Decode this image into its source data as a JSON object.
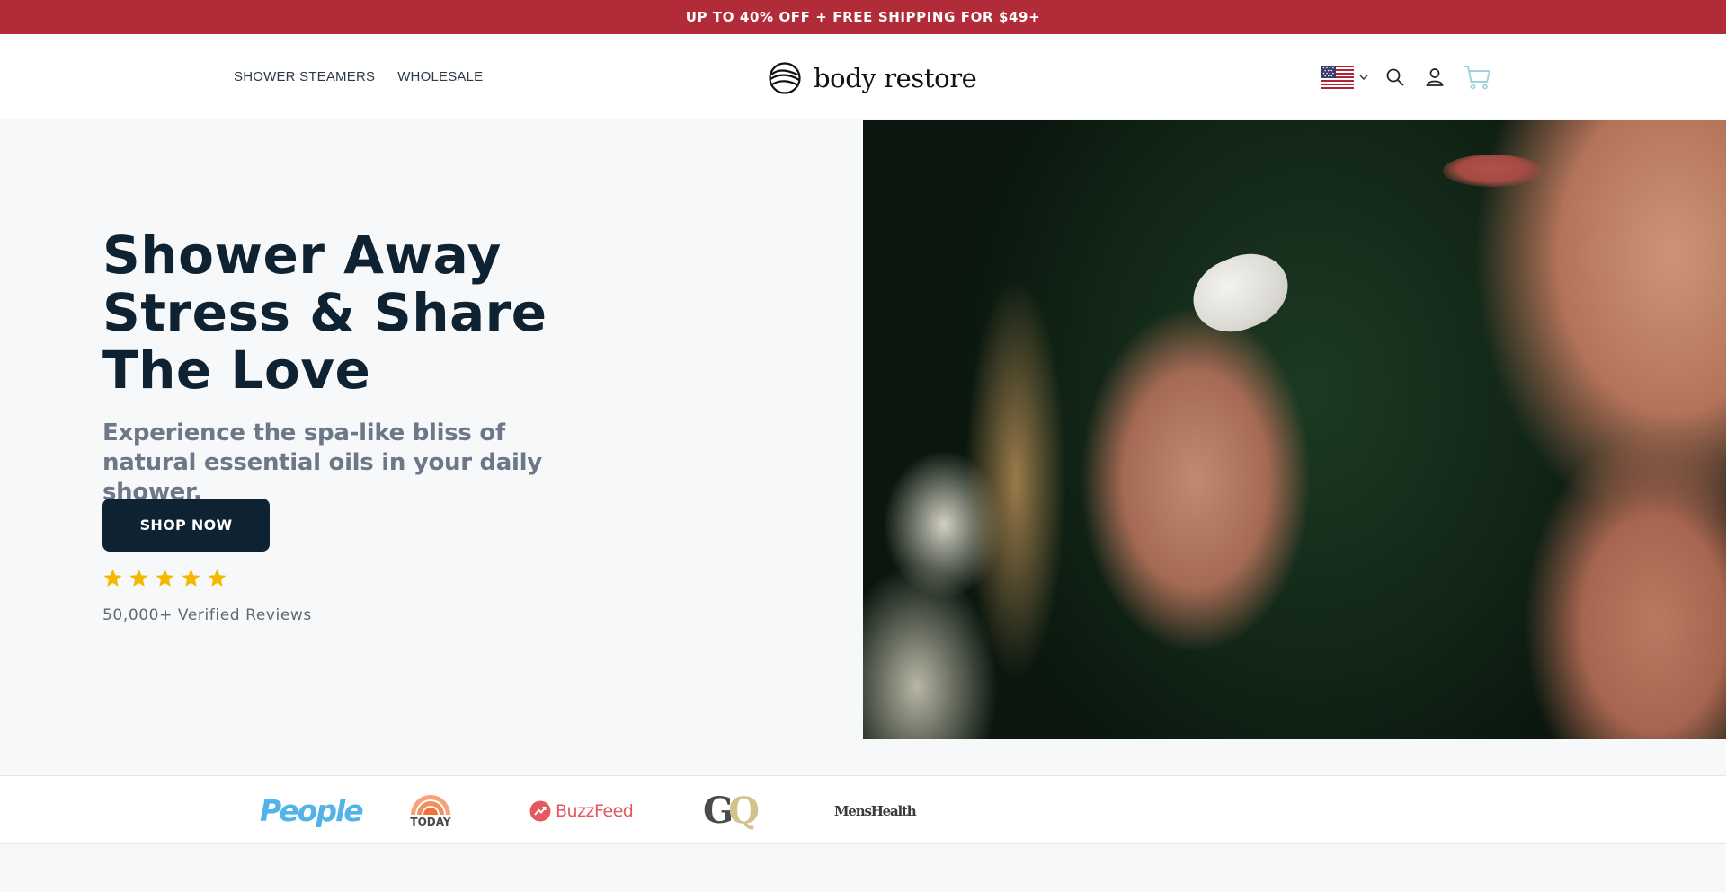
{
  "announcement": {
    "text": "UP TO 40% OFF + FREE SHIPPING FOR $49+"
  },
  "header": {
    "nav": [
      {
        "label": "SHOWER STEAMERS"
      },
      {
        "label": "WHOLESALE"
      }
    ],
    "logo_text": "body restore",
    "icons": {
      "country_flag": "us-flag-icon",
      "search": "search-icon",
      "account": "account-icon",
      "cart": "cart-icon"
    }
  },
  "hero": {
    "headline": "Shower Away Stress & Share The Love",
    "subheadline": "Experience the spa-like bliss of natural essential oils in your daily shower.",
    "cta_label": "SHOP NOW",
    "rating_stars": 5,
    "reviews_text": "50,000+ Verified Reviews",
    "image": "woman holding shower steamer tablet"
  },
  "press": {
    "logos": [
      "People",
      "TODAY",
      "BuzzFeed",
      "GQ",
      "MensHealth"
    ]
  },
  "colors": {
    "announcement_bg": "#b22b39",
    "brand_dark": "#0f2231",
    "subtext": "#6c7787",
    "star": "#f5b800"
  }
}
